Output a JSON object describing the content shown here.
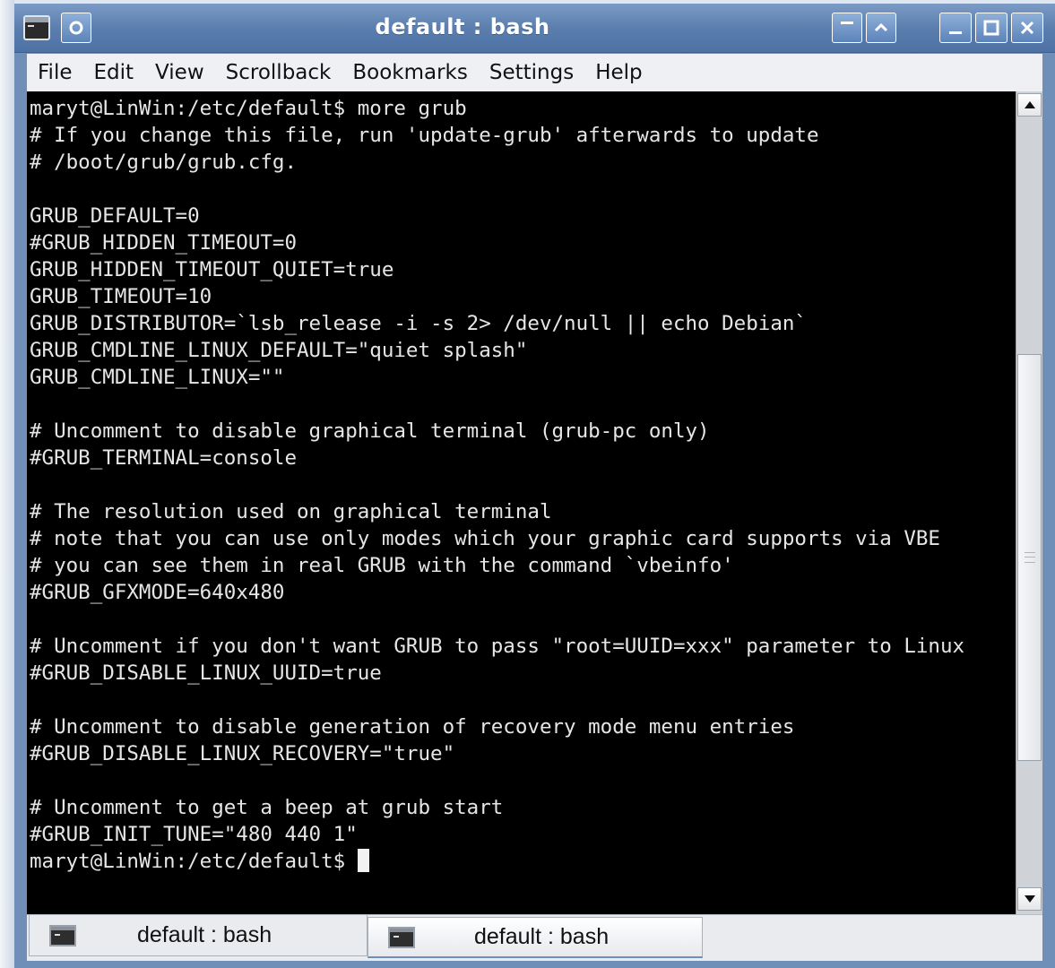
{
  "window": {
    "title": "default : bash"
  },
  "menu": {
    "items": [
      "File",
      "Edit",
      "View",
      "Scrollback",
      "Bookmarks",
      "Settings",
      "Help"
    ]
  },
  "terminal": {
    "lines": [
      "maryt@LinWin:/etc/default$ more grub",
      "# If you change this file, run 'update-grub' afterwards to update",
      "# /boot/grub/grub.cfg.",
      "",
      "GRUB_DEFAULT=0",
      "#GRUB_HIDDEN_TIMEOUT=0",
      "GRUB_HIDDEN_TIMEOUT_QUIET=true",
      "GRUB_TIMEOUT=10",
      "GRUB_DISTRIBUTOR=`lsb_release -i -s 2> /dev/null || echo Debian`",
      "GRUB_CMDLINE_LINUX_DEFAULT=\"quiet splash\"",
      "GRUB_CMDLINE_LINUX=\"\"",
      "",
      "# Uncomment to disable graphical terminal (grub-pc only)",
      "#GRUB_TERMINAL=console",
      "",
      "# The resolution used on graphical terminal",
      "# note that you can use only modes which your graphic card supports via VBE",
      "# you can see them in real GRUB with the command `vbeinfo'",
      "#GRUB_GFXMODE=640x480",
      "",
      "# Uncomment if you don't want GRUB to pass \"root=UUID=xxx\" parameter to Linux",
      "#GRUB_DISABLE_LINUX_UUID=true",
      "",
      "# Uncomment to disable generation of recovery mode menu entries",
      "#GRUB_DISABLE_LINUX_RECOVERY=\"true\"",
      "",
      "# Uncomment to get a beep at grub start",
      "#GRUB_INIT_TUNE=\"480 440 1\""
    ],
    "prompt": "maryt@LinWin:/etc/default$ "
  },
  "tabs": [
    {
      "label": "default : bash",
      "active": true
    },
    {
      "label": "default : bash",
      "active": false
    }
  ],
  "icons": {
    "window_menu": "terminal-icon",
    "sticky": "pin-icon",
    "shade": "minimize-to-titlebar-icon",
    "above": "keep-above-icon",
    "minimize": "minimize-icon",
    "maximize": "maximize-icon",
    "close": "close-icon"
  }
}
